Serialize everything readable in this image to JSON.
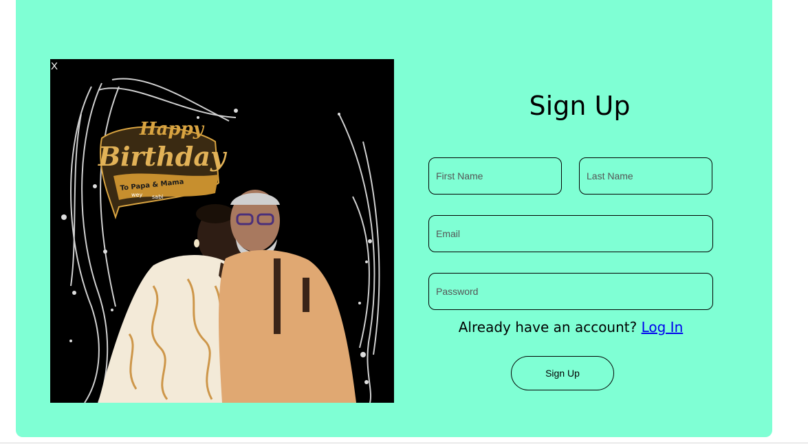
{
  "modal": {
    "close_label": "X",
    "background_color": "#7fffd4"
  },
  "photo": {
    "banner_line1": "Happy",
    "banner_line2": "Birthday",
    "ribbon_text": "To Papa & Mama",
    "ribbon_sub1": "wey",
    "ribbon_sub2": "sabi"
  },
  "form": {
    "title": "Sign Up",
    "first_name_placeholder": "First Name",
    "last_name_placeholder": "Last Name",
    "email_placeholder": "Email",
    "password_placeholder": "Password",
    "login_prompt": "Already have an account?",
    "login_link": "Log In",
    "submit_label": "Sign Up"
  }
}
